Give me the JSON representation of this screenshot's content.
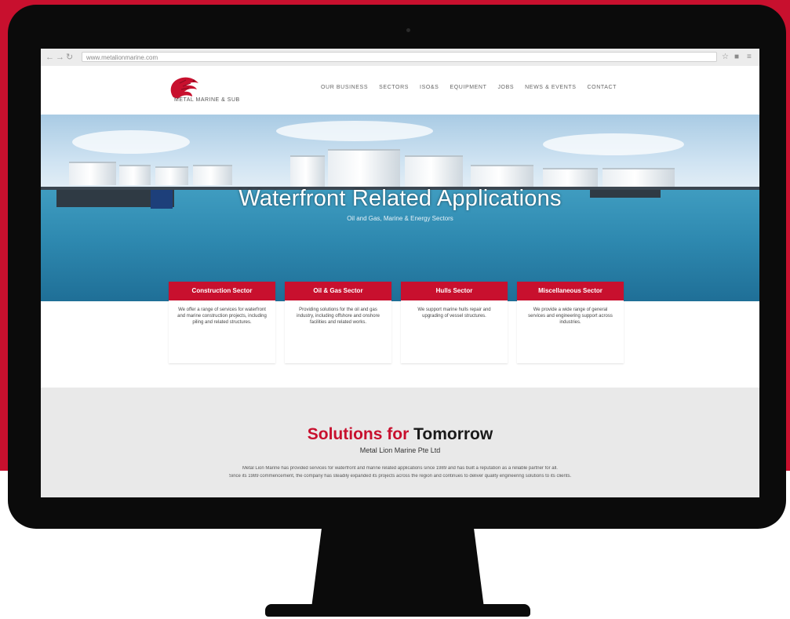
{
  "browser": {
    "url": "www.metalionmarine.com",
    "back_icon": "arrow-left-icon",
    "forward_icon": "arrow-right-icon",
    "reload_icon": "reload-icon",
    "menu_icon": "hamburger-menu-icon"
  },
  "site": {
    "logo_text": "METAL MARINE & SUB",
    "brand_color": "#c8102e"
  },
  "nav": {
    "items": [
      "OUR BUSINESS",
      "SECTORS",
      "ISO&S",
      "EQUIPMENT",
      "JOBS",
      "NEWS & EVENTS",
      "CONTACT"
    ]
  },
  "hero": {
    "title": "Waterfront Related Applications",
    "subtitle": "Oil and Gas, Marine & Energy Sectors"
  },
  "cards": [
    {
      "title": "Construction Sector",
      "text": "We offer a range of services for waterfront and marine construction projects, including piling and related structures."
    },
    {
      "title": "Oil & Gas Sector",
      "text": "Providing solutions for the oil and gas industry, including offshore and onshore facilities and related works."
    },
    {
      "title": "Hulls Sector",
      "text": "We support marine hulls repair and upgrading of vessel structures."
    },
    {
      "title": "Miscellaneous Sector",
      "text": "We provide a wide range of general services and engineering support across industries."
    }
  ],
  "solutions": {
    "title_accent": "Solutions for",
    "title_rest": "Tomorrow",
    "subtitle": "Metal Lion Marine Pte Ltd",
    "paragraph_1": "Metal Lion Marine has provided services for waterfront and marine related applications since 1989 and has built a reputation as a reliable partner for all.",
    "paragraph_2": "Since its 1989 commencement, the company has steadily expanded its projects across the region and continues to deliver quality engineering solutions to its clients."
  }
}
